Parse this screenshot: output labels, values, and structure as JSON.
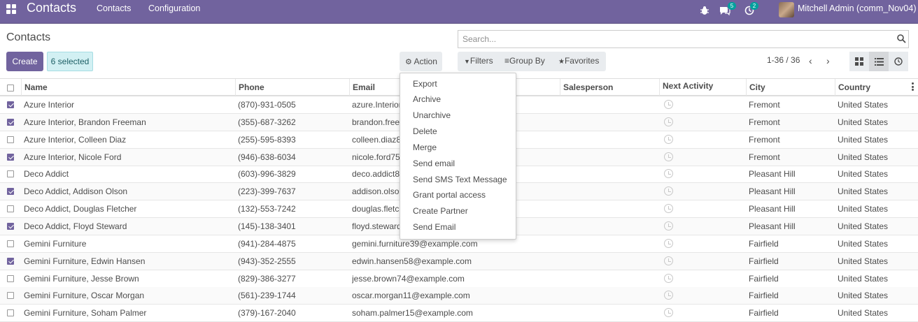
{
  "navbar": {
    "app_name": "Contacts",
    "menu": [
      "Contacts",
      "Configuration"
    ],
    "messages_count": "5",
    "activities_count": "2",
    "user": "Mitchell Admin (comm_Nov04)"
  },
  "control_panel": {
    "title": "Contacts",
    "create_label": "Create",
    "selected_label": "6 selected",
    "action_label": "Action",
    "search_placeholder": "Search...",
    "filters_label": "Filters",
    "group_by_label": "Group By",
    "favorites_label": "Favorites",
    "pager": "1-36 / 36"
  },
  "action_menu": [
    "Export",
    "Archive",
    "Unarchive",
    "Delete",
    "Merge",
    "Send email",
    "Send SMS Text Message",
    "Grant portal access",
    "Create Partner",
    "Send Email"
  ],
  "table": {
    "columns": [
      "Name",
      "Phone",
      "Email",
      "Salesperson",
      "Next Activity",
      "City",
      "Country"
    ],
    "rows": [
      {
        "checked": true,
        "name": "Azure Interior",
        "phone": "(870)-931-0505",
        "email": "azure.Interior24@example.com",
        "city": "Fremont",
        "country": "United States"
      },
      {
        "checked": true,
        "name": "Azure Interior, Brandon Freeman",
        "phone": "(355)-687-3262",
        "email": "brandon.freeman55@example.com",
        "city": "Fremont",
        "country": "United States"
      },
      {
        "checked": false,
        "name": "Azure Interior, Colleen Diaz",
        "phone": "(255)-595-8393",
        "email": "colleen.diaz83@example.com",
        "city": "Fremont",
        "country": "United States"
      },
      {
        "checked": true,
        "name": "Azure Interior, Nicole Ford",
        "phone": "(946)-638-6034",
        "email": "nicole.ford75@example.com",
        "city": "Fremont",
        "country": "United States"
      },
      {
        "checked": false,
        "name": "Deco Addict",
        "phone": "(603)-996-3829",
        "email": "deco.addict82@example.com",
        "city": "Pleasant Hill",
        "country": "United States"
      },
      {
        "checked": true,
        "name": "Deco Addict, Addison Olson",
        "phone": "(223)-399-7637",
        "email": "addison.olson28@example.com",
        "city": "Pleasant Hill",
        "country": "United States"
      },
      {
        "checked": false,
        "name": "Deco Addict, Douglas Fletcher",
        "phone": "(132)-553-7242",
        "email": "douglas.fletcher51@example.com",
        "city": "Pleasant Hill",
        "country": "United States"
      },
      {
        "checked": true,
        "name": "Deco Addict, Floyd Steward",
        "phone": "(145)-138-3401",
        "email": "floyd.steward34@example.com",
        "city": "Pleasant Hill",
        "country": "United States"
      },
      {
        "checked": false,
        "name": "Gemini Furniture",
        "phone": "(941)-284-4875",
        "email": "gemini.furniture39@example.com",
        "city": "Fairfield",
        "country": "United States"
      },
      {
        "checked": true,
        "name": "Gemini Furniture, Edwin Hansen",
        "phone": "(943)-352-2555",
        "email": "edwin.hansen58@example.com",
        "city": "Fairfield",
        "country": "United States"
      },
      {
        "checked": false,
        "name": "Gemini Furniture, Jesse Brown",
        "phone": "(829)-386-3277",
        "email": "jesse.brown74@example.com",
        "city": "Fairfield",
        "country": "United States"
      },
      {
        "checked": false,
        "name": "Gemini Furniture, Oscar Morgan",
        "phone": "(561)-239-1744",
        "email": "oscar.morgan11@example.com",
        "city": "Fairfield",
        "country": "United States"
      },
      {
        "checked": false,
        "name": "Gemini Furniture, Soham Palmer",
        "phone": "(379)-167-2040",
        "email": "soham.palmer15@example.com",
        "city": "Fairfield",
        "country": "United States"
      }
    ]
  },
  "colors": {
    "brand": "#71639e",
    "badge": "#00a09d",
    "selected_bg": "#d2f0f3"
  }
}
